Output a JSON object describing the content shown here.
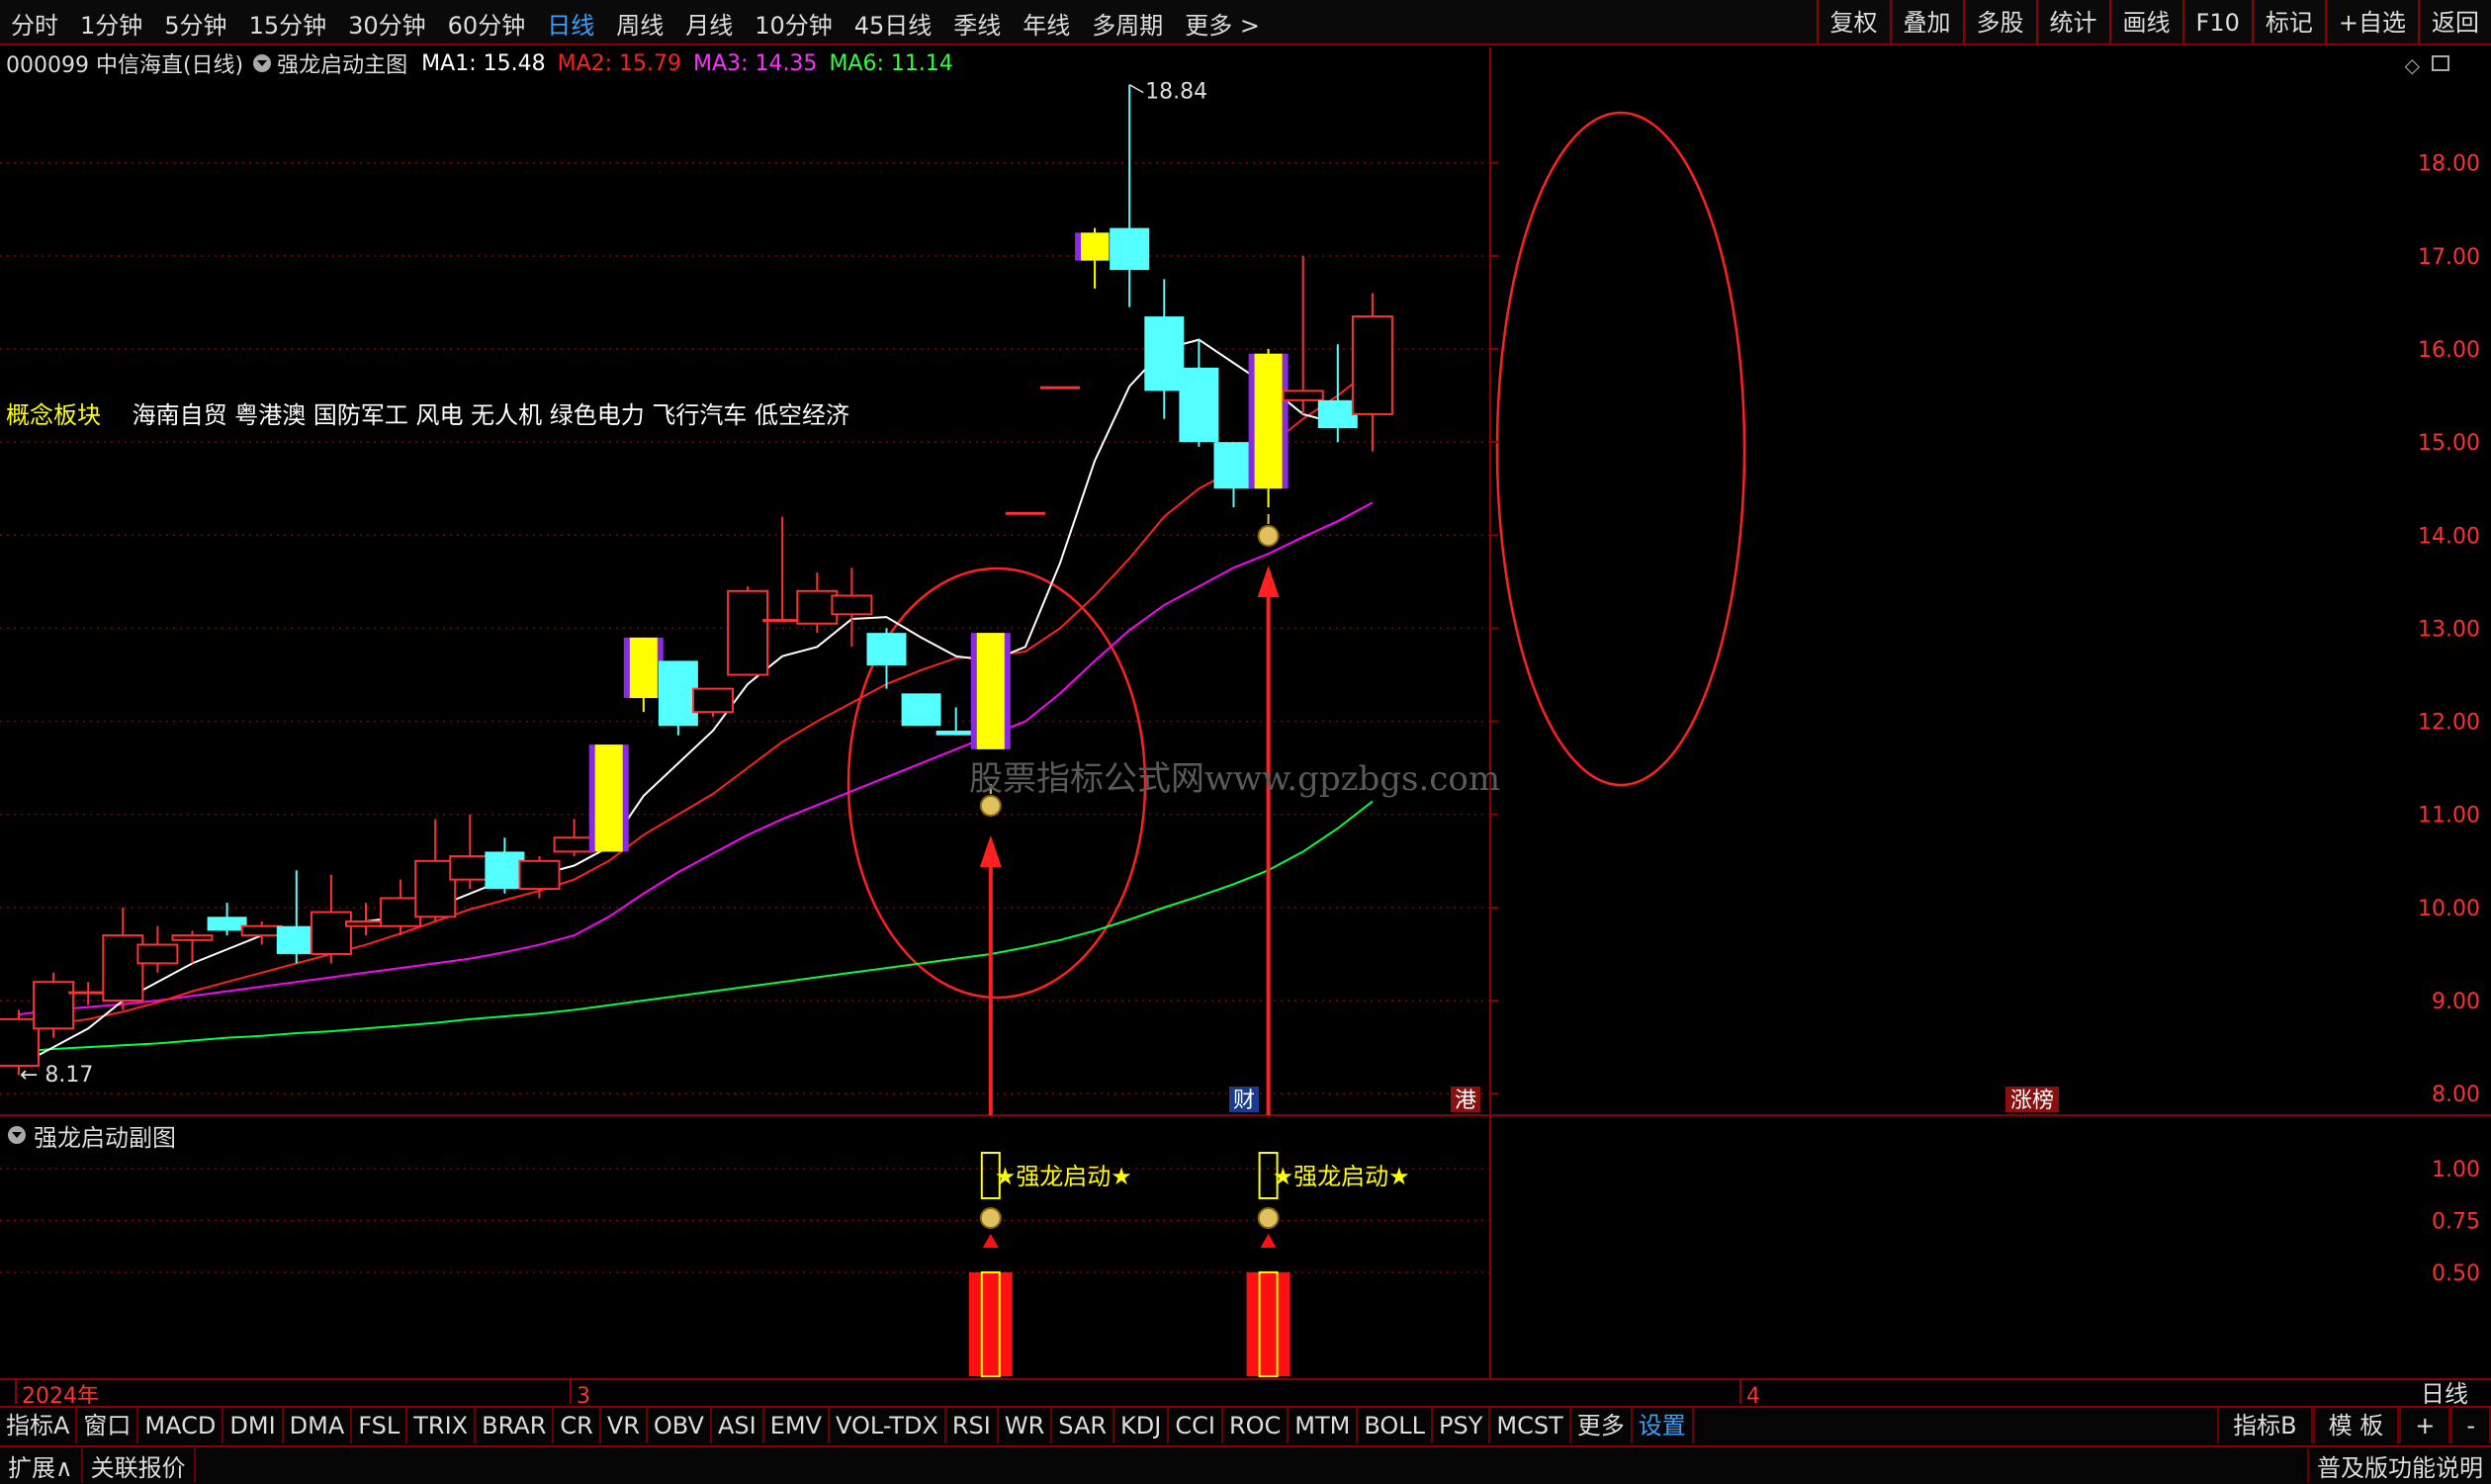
{
  "toolbar": {
    "periods": [
      "分时",
      "1分钟",
      "5分钟",
      "15分钟",
      "30分钟",
      "60分钟",
      "日线",
      "周线",
      "月线",
      "10分钟",
      "45日线",
      "季线",
      "年线",
      "多周期",
      "更多 >"
    ],
    "active_period": "日线",
    "right_buttons": [
      "复权",
      "叠加",
      "多股",
      "统计",
      "画线",
      "F10",
      "标记",
      "+自选",
      "返回"
    ]
  },
  "stock": {
    "code_name": "000099 中信海直(日线)",
    "indicator": "强龙启动主图",
    "ma1": "MA1: 15.48",
    "ma2": "MA2: 15.79",
    "ma3": "MA3: 14.35",
    "ma6": "MA6: 11.14"
  },
  "colors": {
    "ma1": "#ffffff",
    "ma2": "#ff2020",
    "ma3": "#ff00ff",
    "ma6": "#00ff40",
    "up_candle": "#ff3030",
    "down_candle": "#54ffff",
    "signal_candle": "#ffff00",
    "signal_edge": "#8a2be2",
    "grid": "#8b0000",
    "ellipse": "#ff2020",
    "arrow": "#ff2020"
  },
  "concept": {
    "label": "概念板块",
    "tags": "海南自贸 粤港澳 国防军工 风电 无人机 绿色电力 飞行汽车 低空经济"
  },
  "watermark": "股票指标公式网www.gpzbgs.com",
  "main_axis": {
    "ticks": [
      "18.00",
      "17.00",
      "16.00",
      "15.00",
      "14.00",
      "13.00",
      "12.00",
      "11.00",
      "10.00",
      "9.00",
      "8.00"
    ]
  },
  "sub_axis": {
    "ticks": [
      "1.00",
      "0.75",
      "0.50"
    ]
  },
  "price_marks": {
    "high": "18.84",
    "low": "8.17"
  },
  "event_labels": [
    "财",
    "港",
    "涨榜"
  ],
  "sub_chart": {
    "title": "强龙启动副图",
    "signal_label": "★强龙启动★"
  },
  "time_labels": [
    "2024年",
    "3",
    "4"
  ],
  "bottom_right_label": "日线",
  "indicator_tabs": [
    "指标A",
    "窗口",
    "MACD",
    "DMI",
    "DMA",
    "FSL",
    "TRIX",
    "BRAR",
    "CR",
    "VR",
    "OBV",
    "ASI",
    "EMV",
    "VOL-TDX",
    "RSI",
    "WR",
    "SAR",
    "KDJ",
    "CCI",
    "ROC",
    "MTM",
    "BOLL",
    "PSY",
    "MCST",
    "更多",
    "设置"
  ],
  "indicator_right": [
    "指标B",
    "模 板",
    "+",
    "-"
  ],
  "status_left": [
    "扩展∧",
    "关联报价"
  ],
  "status_right": "普及版功能说明",
  "chart_data": {
    "type": "candlestick",
    "ylim": [
      7.8,
      18.9
    ],
    "candles": [
      {
        "o": 8.3,
        "h": 8.9,
        "l": 8.2,
        "c": 8.8
      },
      {
        "o": 8.7,
        "h": 9.3,
        "l": 8.6,
        "c": 9.2
      },
      {
        "o": 9.1,
        "h": 9.2,
        "l": 8.95,
        "c": 9.1
      },
      {
        "o": 9.0,
        "h": 10.0,
        "l": 8.9,
        "c": 9.7
      },
      {
        "o": 9.4,
        "h": 9.8,
        "l": 9.3,
        "c": 9.6
      },
      {
        "o": 9.65,
        "h": 9.75,
        "l": 9.4,
        "c": 9.7
      },
      {
        "o": 9.9,
        "h": 10.05,
        "l": 9.7,
        "c": 9.75
      },
      {
        "o": 9.7,
        "h": 9.85,
        "l": 9.6,
        "c": 9.8
      },
      {
        "o": 9.8,
        "h": 10.4,
        "l": 9.4,
        "c": 9.5
      },
      {
        "o": 9.5,
        "h": 10.35,
        "l": 9.4,
        "c": 9.95
      },
      {
        "o": 9.8,
        "h": 10.05,
        "l": 9.7,
        "c": 9.85
      },
      {
        "o": 9.8,
        "h": 10.3,
        "l": 9.7,
        "c": 10.1
      },
      {
        "o": 9.9,
        "h": 10.95,
        "l": 9.85,
        "c": 10.5
      },
      {
        "o": 10.3,
        "h": 11.0,
        "l": 10.2,
        "c": 10.55
      },
      {
        "o": 10.6,
        "h": 10.75,
        "l": 10.15,
        "c": 10.2
      },
      {
        "o": 10.2,
        "h": 10.55,
        "l": 10.1,
        "c": 10.5
      },
      {
        "o": 10.6,
        "h": 10.95,
        "l": 10.55,
        "c": 10.75
      },
      {
        "o": 10.6,
        "h": 11.75,
        "l": 10.6,
        "c": 11.75
      },
      {
        "o": 12.25,
        "h": 12.9,
        "l": 12.1,
        "c": 12.9
      },
      {
        "o": 12.65,
        "h": 12.65,
        "l": 11.85,
        "c": 11.95
      },
      {
        "o": 12.1,
        "h": 12.35,
        "l": 12.05,
        "c": 12.35
      },
      {
        "o": 12.5,
        "h": 13.45,
        "l": 12.5,
        "c": 13.4
      },
      {
        "o": 13.1,
        "h": 14.2,
        "l": 13.1,
        "c": 13.1
      },
      {
        "o": 13.05,
        "h": 13.6,
        "l": 12.95,
        "c": 13.4
      },
      {
        "o": 13.15,
        "h": 13.65,
        "l": 12.8,
        "c": 13.35
      },
      {
        "o": 12.95,
        "h": 13.0,
        "l": 12.35,
        "c": 12.6
      },
      {
        "o": 12.3,
        "h": 12.3,
        "l": 11.95,
        "c": 11.95
      },
      {
        "o": 11.9,
        "h": 12.15,
        "l": 11.85,
        "c": 11.85
      },
      {
        "o": 11.7,
        "h": 12.95,
        "l": 11.7,
        "c": 12.95
      },
      {
        "o": 14.25,
        "h": 14.25,
        "l": 14.25,
        "c": 14.25
      },
      {
        "o": 15.6,
        "h": 15.6,
        "l": 15.6,
        "c": 15.6
      },
      {
        "o": 16.95,
        "h": 17.3,
        "l": 16.65,
        "c": 17.25
      },
      {
        "o": 17.3,
        "h": 18.84,
        "l": 16.45,
        "c": 16.85
      },
      {
        "o": 16.35,
        "h": 16.75,
        "l": 15.25,
        "c": 15.55
      },
      {
        "o": 15.8,
        "h": 16.1,
        "l": 14.95,
        "c": 15.0
      },
      {
        "o": 15.0,
        "h": 15.0,
        "l": 14.3,
        "c": 14.5
      },
      {
        "o": 14.5,
        "h": 16.0,
        "l": 14.3,
        "c": 15.95
      },
      {
        "o": 15.45,
        "h": 17.0,
        "l": 15.3,
        "c": 15.55
      },
      {
        "o": 15.45,
        "h": 16.05,
        "l": 15.0,
        "c": 15.15
      },
      {
        "o": 15.3,
        "h": 16.6,
        "l": 14.9,
        "c": 16.35
      }
    ],
    "signal_candles": [
      17,
      18,
      28,
      31,
      36
    ],
    "ma1": [
      8.3,
      8.5,
      8.7,
      9.0,
      9.2,
      9.4,
      9.55,
      9.7,
      9.75,
      9.8,
      9.85,
      9.9,
      10.0,
      10.15,
      10.3,
      10.35,
      10.45,
      10.65,
      11.2,
      11.55,
      11.9,
      12.4,
      12.7,
      12.8,
      13.1,
      13.12,
      12.9,
      12.7,
      12.65,
      12.8,
      13.7,
      14.8,
      15.6,
      16.0,
      16.1,
      15.85,
      15.6,
      15.3,
      15.2,
      15.48
    ],
    "ma2": [
      8.7,
      8.75,
      8.8,
      8.88,
      8.98,
      9.1,
      9.2,
      9.3,
      9.4,
      9.5,
      9.6,
      9.72,
      9.85,
      9.98,
      10.08,
      10.18,
      10.3,
      10.5,
      10.78,
      11.0,
      11.22,
      11.5,
      11.78,
      12.0,
      12.2,
      12.4,
      12.55,
      12.68,
      12.7,
      12.75,
      13.0,
      13.35,
      13.75,
      14.2,
      14.5,
      14.7,
      14.95,
      15.25,
      15.5,
      15.79
    ],
    "ma3": [
      8.85,
      8.9,
      8.93,
      8.96,
      9.0,
      9.05,
      9.1,
      9.15,
      9.2,
      9.25,
      9.3,
      9.35,
      9.4,
      9.45,
      9.52,
      9.6,
      9.7,
      9.9,
      10.15,
      10.38,
      10.58,
      10.78,
      10.95,
      11.1,
      11.25,
      11.4,
      11.55,
      11.7,
      11.85,
      12.0,
      12.3,
      12.65,
      12.98,
      13.25,
      13.45,
      13.65,
      13.8,
      13.98,
      14.15,
      14.35
    ],
    "ma6": [
      8.45,
      8.48,
      8.5,
      8.52,
      8.54,
      8.57,
      8.6,
      8.62,
      8.65,
      8.67,
      8.7,
      8.73,
      8.76,
      8.8,
      8.83,
      8.86,
      8.9,
      8.95,
      9.0,
      9.05,
      9.1,
      9.15,
      9.2,
      9.25,
      9.3,
      9.35,
      9.4,
      9.45,
      9.5,
      9.57,
      9.65,
      9.75,
      9.87,
      10.0,
      10.12,
      10.25,
      10.4,
      10.6,
      10.85,
      11.14
    ],
    "sub_signal_bars": [
      28,
      36
    ],
    "sub_signal_value": 0.5
  }
}
